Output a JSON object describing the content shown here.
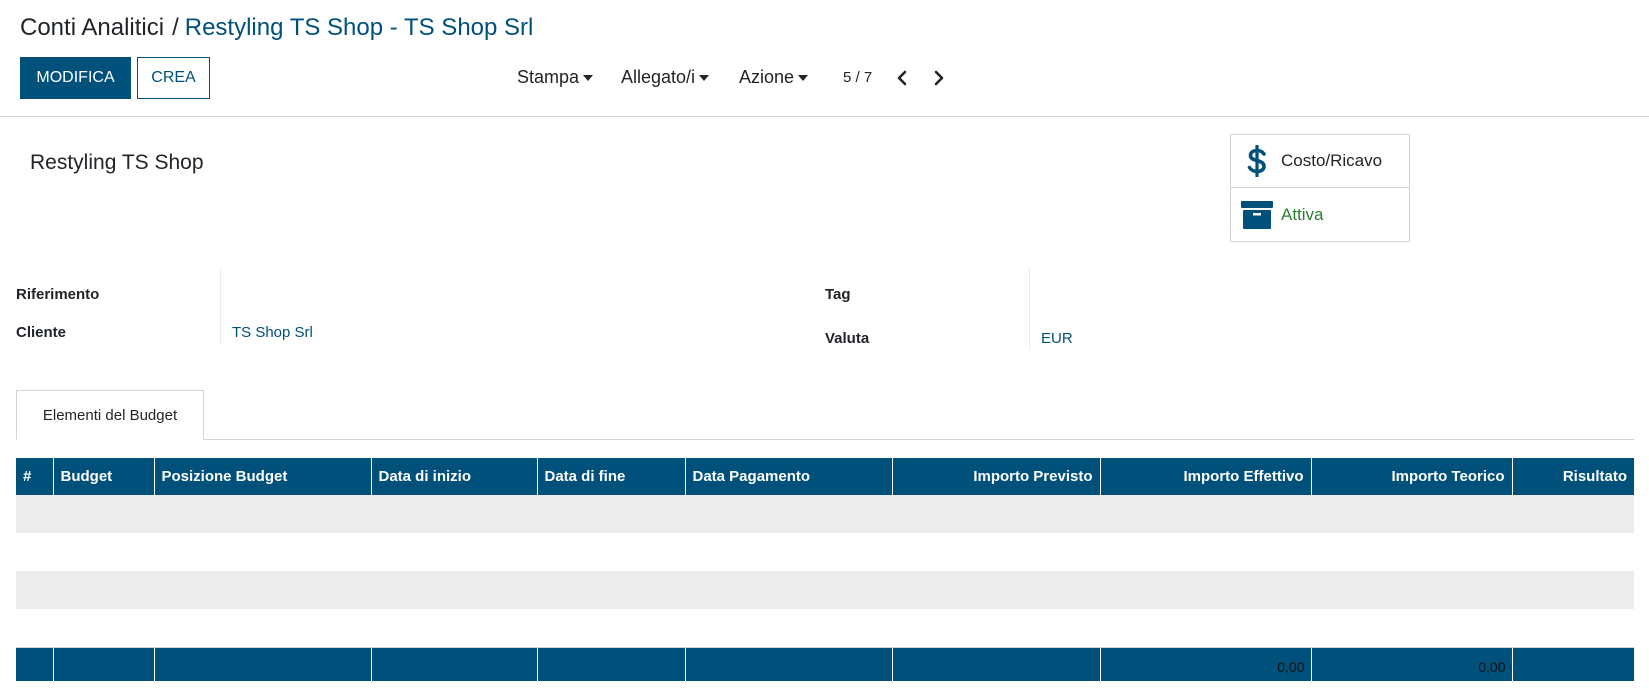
{
  "breadcrumb": {
    "root": "Conti Analitici",
    "separator": "/",
    "current": "Restyling TS Shop - TS Shop Srl"
  },
  "toolbar": {
    "edit_label": "MODIFICA",
    "create_label": "CREA",
    "print_label": "Stampa",
    "attachments_label": "Allegato/i",
    "action_label": "Azione"
  },
  "pager": {
    "value": "5 / 7"
  },
  "record": {
    "name": "Restyling TS Shop"
  },
  "stat_buttons": {
    "cost_revenue_label": "Costo/Ricavo",
    "active_label": "Attiva"
  },
  "fields": {
    "reference_label": "Riferimento",
    "reference_value": "",
    "customer_label": "Cliente",
    "customer_value": "TS Shop Srl",
    "tag_label": "Tag",
    "tag_value": "",
    "currency_label": "Valuta",
    "currency_value": "EUR"
  },
  "tabs": [
    {
      "label": "Elementi del Budget"
    }
  ],
  "budget_table": {
    "columns": [
      "#",
      "Budget",
      "Posizione Budget",
      "Data di inizio",
      "Data di fine",
      "Data Pagamento",
      "Importo Previsto",
      "Importo Effettivo",
      "Importo Teorico",
      "Risultato"
    ],
    "footer": {
      "importo_effettivo_total": "0,00",
      "importo_teorico_total": "0,00"
    }
  },
  "colors": {
    "primary": "#00507c",
    "active_green": "#2e7d32"
  }
}
